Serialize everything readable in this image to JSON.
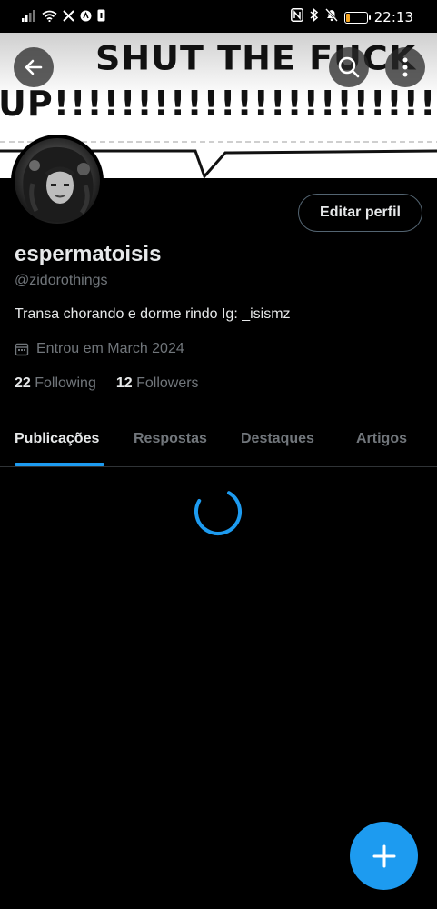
{
  "status_bar": {
    "time": "22:13",
    "battery_level": "19",
    "battery_fraction": 0.19,
    "left_icons": [
      "signal-icon",
      "wifi-icon",
      "x-app-icon",
      "app-notification-icon",
      "phone-notification-icon"
    ],
    "right_icons": [
      "nfc-icon",
      "bluetooth-icon",
      "mute-icon",
      "battery-icon"
    ]
  },
  "banner": {
    "line1": "SHUT THE FUCK",
    "line2": "UP!!!!!!!!!!!!!!!!!!!!!!!!!!!"
  },
  "profile": {
    "name": "espermatoisis",
    "handle": "@zidorothings",
    "bio": "Transa chorando e dorme rindo Ig: _isismz",
    "joined": "Entrou em March 2024",
    "following_count": "22",
    "following_label": "Following",
    "followers_count": "12",
    "followers_label": "Followers",
    "edit_label": "Editar perfil"
  },
  "tabs": [
    {
      "label": "Publicações",
      "active": true
    },
    {
      "label": "Respostas",
      "active": false
    },
    {
      "label": "Destaques",
      "active": false
    },
    {
      "label": "Artigos",
      "active": false
    }
  ],
  "colors": {
    "accent": "#1d9bf0",
    "background": "#000000",
    "secondary_text": "#71767b",
    "battery": "#f5a623"
  }
}
